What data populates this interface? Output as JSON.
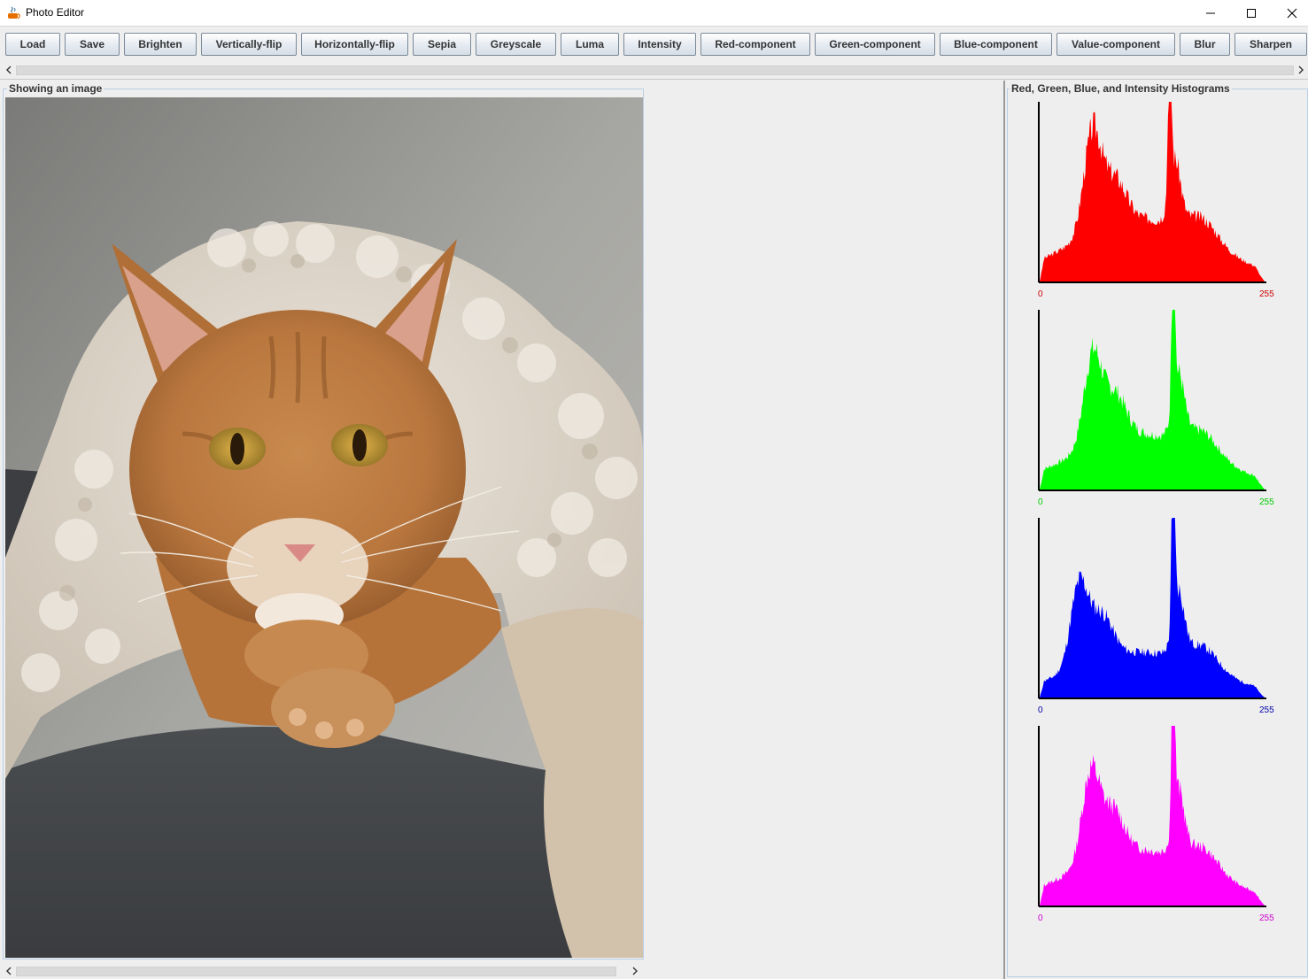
{
  "window": {
    "title": "Photo Editor"
  },
  "toolbar": {
    "buttons": [
      {
        "label": "Load"
      },
      {
        "label": "Save"
      },
      {
        "label": "Brighten"
      },
      {
        "label": "Vertically-flip"
      },
      {
        "label": "Horizontally-flip"
      },
      {
        "label": "Sepia"
      },
      {
        "label": "Greyscale"
      },
      {
        "label": "Luma"
      },
      {
        "label": "Intensity"
      },
      {
        "label": "Red-component"
      },
      {
        "label": "Green-component"
      },
      {
        "label": "Blue-component"
      },
      {
        "label": "Value-component"
      },
      {
        "label": "Blur"
      },
      {
        "label": "Sharpen"
      }
    ]
  },
  "image_panel": {
    "title": "Showing an image"
  },
  "histogram_panel": {
    "title": "Red, Green, Blue, and Intensity Histograms",
    "histograms": [
      {
        "name": "red",
        "color": "#ff0000",
        "axis_color": "#cc0000",
        "min_label": "0",
        "max_label": "255"
      },
      {
        "name": "green",
        "color": "#00ff00",
        "axis_color": "#00cc00",
        "min_label": "0",
        "max_label": "255"
      },
      {
        "name": "blue",
        "color": "#0000ff",
        "axis_color": "#0000aa",
        "min_label": "0",
        "max_label": "255"
      },
      {
        "name": "intensity",
        "color": "#ff00ff",
        "axis_color": "#cc00cc",
        "min_label": "0",
        "max_label": "255"
      }
    ]
  }
}
